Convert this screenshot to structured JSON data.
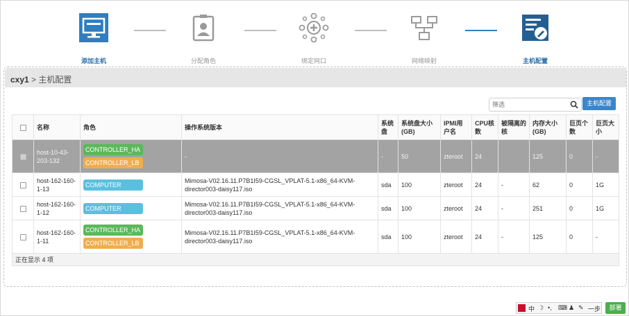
{
  "steps": [
    {
      "label": "添加主机",
      "icon": "monitor-icon",
      "active": true
    },
    {
      "label": "分配角色",
      "icon": "id-badge-icon",
      "active": false
    },
    {
      "label": "绑定网口",
      "icon": "network-interface-icon",
      "active": false
    },
    {
      "label": "网络映射",
      "icon": "network-map-icon",
      "active": false
    },
    {
      "label": "主机配置",
      "icon": "server-settings-icon",
      "active": true
    }
  ],
  "breadcrumb": {
    "cluster": "cxy1",
    "separator": ">",
    "page": "主机配置"
  },
  "toolbar": {
    "filter_placeholder": "筛选",
    "config_button": "主机配置"
  },
  "table": {
    "headers": {
      "name": "名称",
      "role": "角色",
      "os": "操作系统版本",
      "sys_disk": "系统盘",
      "sys_disk_size": "系统盘大小(GB)",
      "ipmi_user": "IPMI用户名",
      "cpu": "CPU核数",
      "isolated": "被隔离的核",
      "mem": "内存大小(GB)",
      "hugepage_count": "巨页个数",
      "hugepage_size": "巨页大小"
    },
    "rows": [
      {
        "name": "host-10-43-203-132",
        "roles": [
          "CONTROLLER_HA",
          "CONTROLLER_LB"
        ],
        "os": "-",
        "sys_disk": "-",
        "sys_disk_size": "50",
        "ipmi_user": "zteroot",
        "cpu": "24",
        "isolated": "",
        "mem": "125",
        "hugepage_count": "0",
        "hugepage_size": "-",
        "selected": true
      },
      {
        "name": "host-162-160-1-13",
        "roles": [
          "COMPUTER"
        ],
        "os": "Mimosa-V02.16.11.P7B1I59-CGSL_VPLAT-5.1-x86_64-KVM-director003-daisy117.iso",
        "sys_disk": "sda",
        "sys_disk_size": "100",
        "ipmi_user": "zteroot",
        "cpu": "24",
        "isolated": "-",
        "mem": "62",
        "hugepage_count": "0",
        "hugepage_size": "1G",
        "selected": false
      },
      {
        "name": "host-162-160-1-12",
        "roles": [
          "COMPUTER"
        ],
        "os": "Mimosa-V02.16.11.P7B1I59-CGSL_VPLAT-5.1-x86_64-KVM-director003-daisy117.iso",
        "sys_disk": "sda",
        "sys_disk_size": "100",
        "ipmi_user": "zteroot",
        "cpu": "24",
        "isolated": "-",
        "mem": "251",
        "hugepage_count": "0",
        "hugepage_size": "1G",
        "selected": false
      },
      {
        "name": "host-162-160-1-11",
        "roles": [
          "CONTROLLER_HA",
          "CONTROLLER_LB"
        ],
        "os": "Mimosa-V02.16.11.P7B1I59-CGSL_VPLAT-5.1-x86_64-KVM-director003-daisy117.iso",
        "sys_disk": "sda",
        "sys_disk_size": "100",
        "ipmi_user": "zteroot",
        "cpu": "24",
        "isolated": "-",
        "mem": "125",
        "hugepage_count": "0",
        "hugepage_size": "-",
        "selected": false
      }
    ],
    "footer": "正在显示 4 项"
  },
  "role_colors": {
    "CONTROLLER_HA": "#5cb85c",
    "CONTROLLER_LB": "#f0ad4e",
    "COMPUTER": "#5bc0de"
  },
  "bottom": {
    "ime_text": "中",
    "prev_button": "一步",
    "deploy_button": "部署"
  },
  "colors": {
    "accent": "#3a86c8",
    "deploy": "#4cae4c",
    "selected_row": "#a3a3a3"
  }
}
